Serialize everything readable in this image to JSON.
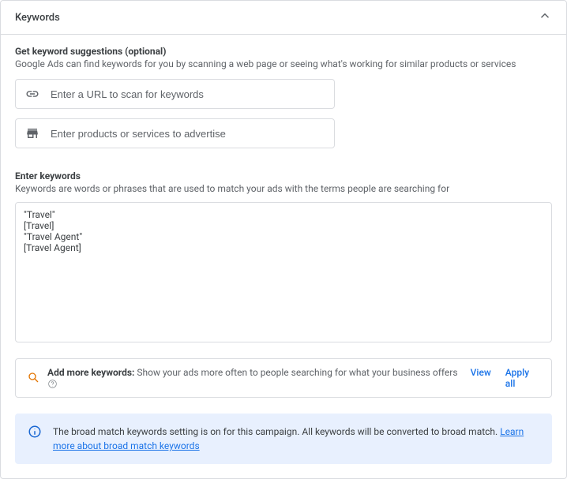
{
  "card": {
    "title": "Keywords"
  },
  "suggest": {
    "heading": "Get keyword suggestions (optional)",
    "sub": "Google Ads can find keywords for you by scanning a web page or seeing what's working for similar products or services",
    "url_placeholder": "Enter a URL to scan for keywords",
    "products_placeholder": "Enter products or services to advertise"
  },
  "enter": {
    "heading": "Enter keywords",
    "sub": "Keywords are words or phrases that are used to match your ads with the terms people are searching for",
    "value": "\"Travel\"\n[Travel]\n\"Travel Agent\"\n[Travel Agent]"
  },
  "add_more": {
    "strong": "Add more keywords:",
    "desc": " Show your ads more often to people searching for what your business offers ",
    "view": "View",
    "apply_all": "Apply all"
  },
  "banner": {
    "text_before": "The broad match keywords setting is on for this campaign. All keywords will be converted to broad match. ",
    "link": "Learn more about broad match keywords"
  }
}
